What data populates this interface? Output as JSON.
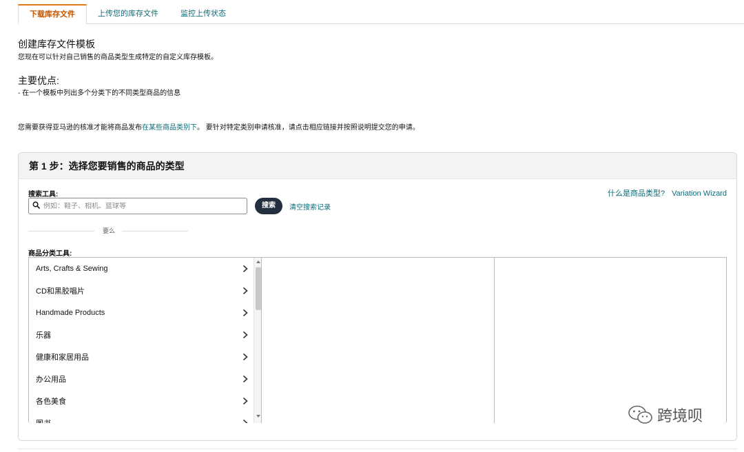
{
  "tabs": [
    {
      "label": "下载库存文件",
      "active": true
    },
    {
      "label": "上传您的库存文件",
      "active": false
    },
    {
      "label": "监控上传状态",
      "active": false
    }
  ],
  "intro": {
    "title": "创建库存文件模板",
    "desc": "您现在可以针对自己销售的商品类型生成特定的自定义库存模板。",
    "benefits_title": "主要优点:",
    "benefit_1": "- 在一个模板中列出多个分类下的不同类型商品的信息"
  },
  "notice": {
    "before": "您需要获得亚马逊的核准才能将商品发布",
    "link": "在某些商品类别下",
    "after": "。 要针对特定类别申请核准，请点击相应链接并按照说明提交您的申请。"
  },
  "step1": {
    "title": "第 1 步：选择您要销售的商品的类型",
    "search_label": "搜索工具:",
    "search_placeholder": "例如：鞋子、相机、篮球等",
    "search_button": "搜索",
    "clear_link": "清空搜索记录",
    "what_is_link": "什么是商品类型?",
    "variation_link": "Variation Wizard",
    "or_text": "要么",
    "category_label": "商品分类工具:",
    "categories": [
      "Arts, Crafts & Sewing",
      "CD和黑胶唱片",
      "Handmade Products",
      "乐器",
      "健康和家居用品",
      "办公用品",
      "各色美食",
      "图书"
    ]
  },
  "watermark": {
    "text": "跨境呗"
  },
  "colors": {
    "link": "#0f6b78",
    "active_tab": "#c45500",
    "tab_accent": "#e47911",
    "button_dark": "#232f3e"
  }
}
